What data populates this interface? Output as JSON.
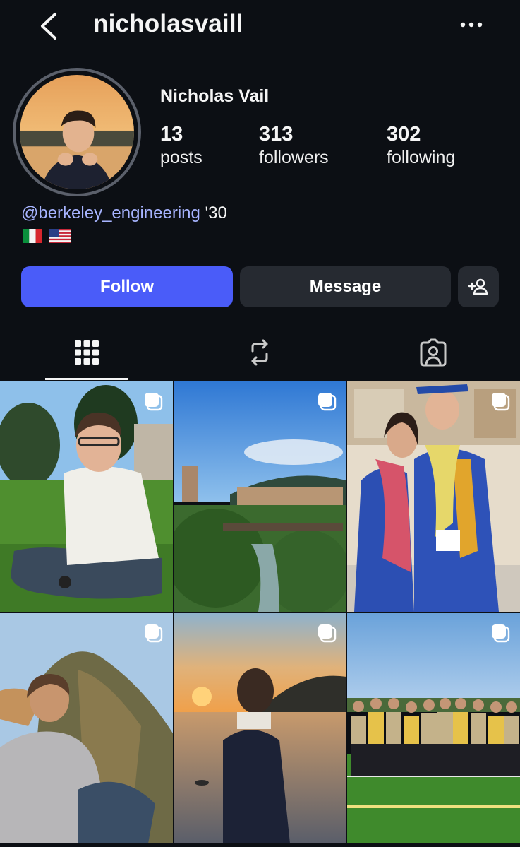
{
  "header": {
    "username": "nicholasvaill",
    "back_icon": "chevron-left-icon",
    "more_icon": "more-dots-icon"
  },
  "profile": {
    "full_name": "Nicholas Vail",
    "stats": [
      {
        "value": "13",
        "label": "posts"
      },
      {
        "value": "313",
        "label": "followers"
      },
      {
        "value": "302",
        "label": "following"
      }
    ],
    "bio_link": "@berkeley_engineering",
    "bio_suffix": " '30",
    "flags": [
      "italy-flag",
      "usa-flag"
    ]
  },
  "actions": {
    "follow_label": "Follow",
    "message_label": "Message",
    "add_user_icon": "add-person-icon"
  },
  "tabs": [
    {
      "name": "grid",
      "icon": "grid-icon",
      "active": true
    },
    {
      "name": "reposts",
      "icon": "repost-icon",
      "active": false
    },
    {
      "name": "tagged",
      "icon": "tagged-person-icon",
      "active": false
    }
  ],
  "posts": [
    {
      "subject": "young man sitting on grass in park",
      "multi": true
    },
    {
      "subject": "hillside town with river and bridge",
      "multi": true
    },
    {
      "subject": "graduation photo with leis",
      "multi": true
    },
    {
      "subject": "person on rocky cliff at sunset",
      "multi": true
    },
    {
      "subject": "person by lake at sunset",
      "multi": true
    },
    {
      "subject": "group photo on sports field",
      "multi": true
    }
  ],
  "colors": {
    "background": "#0c0f14",
    "follow_button": "#4a5cf9",
    "secondary_button": "#262a31",
    "link": "#a7b4ff"
  }
}
